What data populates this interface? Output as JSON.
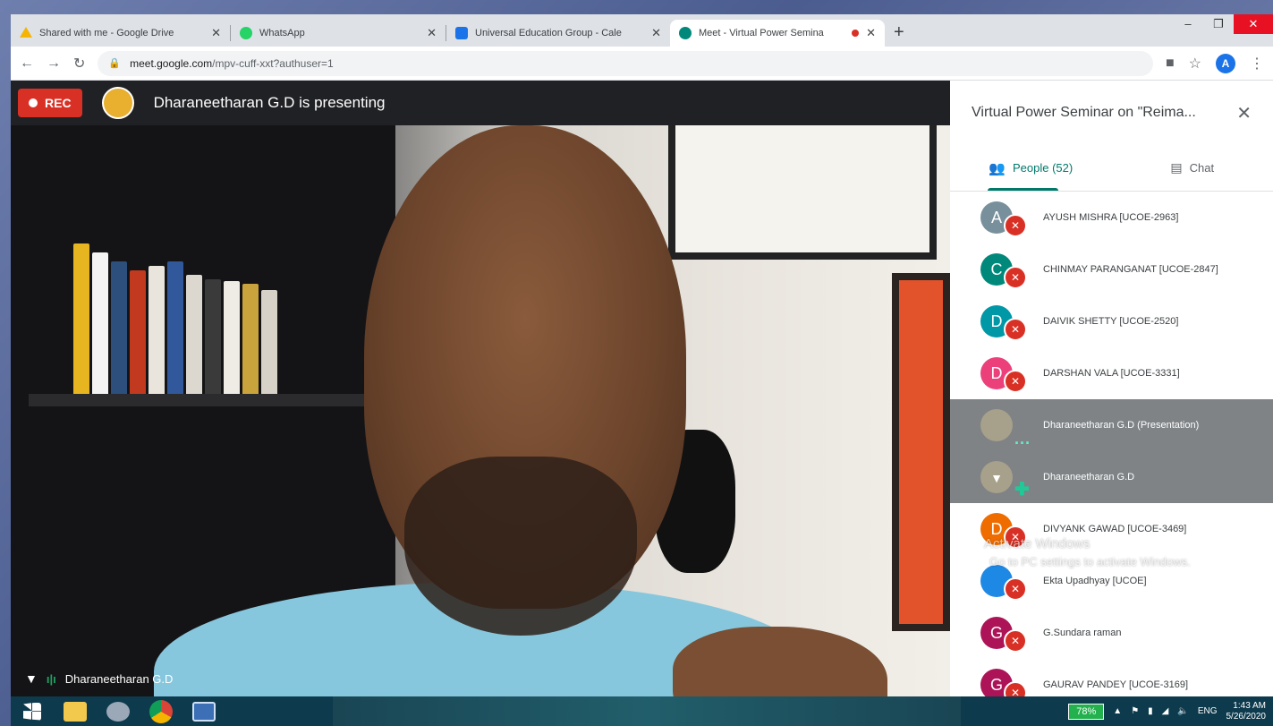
{
  "browser": {
    "tabs": [
      {
        "title": "Shared with me - Google Drive",
        "favicon_color": "#f4b400",
        "active": false
      },
      {
        "title": "WhatsApp",
        "favicon_color": "#25d366",
        "active": false
      },
      {
        "title": "Universal Education Group - Cale",
        "favicon_color": "#1a73e8",
        "active": false
      },
      {
        "title": "Meet - Virtual Power Semina",
        "favicon_color": "#00897b",
        "active": true
      }
    ],
    "new_tab": "+",
    "window_controls": {
      "minimize": "–",
      "restore": "❐",
      "close": "✕"
    },
    "url_host": "meet.google.com",
    "url_path": "/mpv-cuff-xxt?authuser=1",
    "account_initial": "A"
  },
  "meet": {
    "rec_label": "REC",
    "presenting_text": "Dharaneetharan G.D is presenting",
    "video_name": "Dharaneetharan G.D",
    "panel_title": "Virtual Power Seminar on \"Reima...",
    "tabs": {
      "people": "People (52)",
      "chat": "Chat"
    },
    "participants": [
      {
        "initial": "A",
        "color": "#78909c",
        "name": "AYUSH MISHRA [UCOE-2963]",
        "state": "muted"
      },
      {
        "initial": "C",
        "color": "#00897b",
        "name": "CHINMAY PARANGANAT [UCOE-2847]",
        "state": "muted"
      },
      {
        "initial": "D",
        "color": "#0097a7",
        "name": "DAIVIK SHETTY [UCOE-2520]",
        "state": "muted"
      },
      {
        "initial": "D",
        "color": "#ec407a",
        "name": "DARSHAN VALA [UCOE-3331]",
        "state": "muted"
      },
      {
        "initial": "",
        "color": "#a7a08a",
        "name": "Dharaneetharan G.D (Presentation)",
        "state": "presenting"
      },
      {
        "initial": "",
        "color": "#a7a08a",
        "name": "Dharaneetharan G.D",
        "state": "speaking"
      },
      {
        "initial": "D",
        "color": "#ef6c00",
        "name": "DIVYANK GAWAD [UCOE-3469]",
        "state": "muted"
      },
      {
        "initial": "",
        "color": "#1e88e5",
        "name": "Ekta Upadhyay [UCOE]",
        "state": "muted"
      },
      {
        "initial": "G",
        "color": "#ad1457",
        "name": "G.Sundara raman",
        "state": "muted"
      },
      {
        "initial": "G",
        "color": "#ad1457",
        "name": "GAURAV PANDEY [UCOE-3169]",
        "state": "muted"
      }
    ]
  },
  "watermark": {
    "line1": "Activate Windows",
    "line2": "Go to PC settings to activate Windows."
  },
  "taskbar": {
    "battery": "78%",
    "lang": "ENG",
    "time": "1:43 AM",
    "date": "5/26/2020"
  }
}
